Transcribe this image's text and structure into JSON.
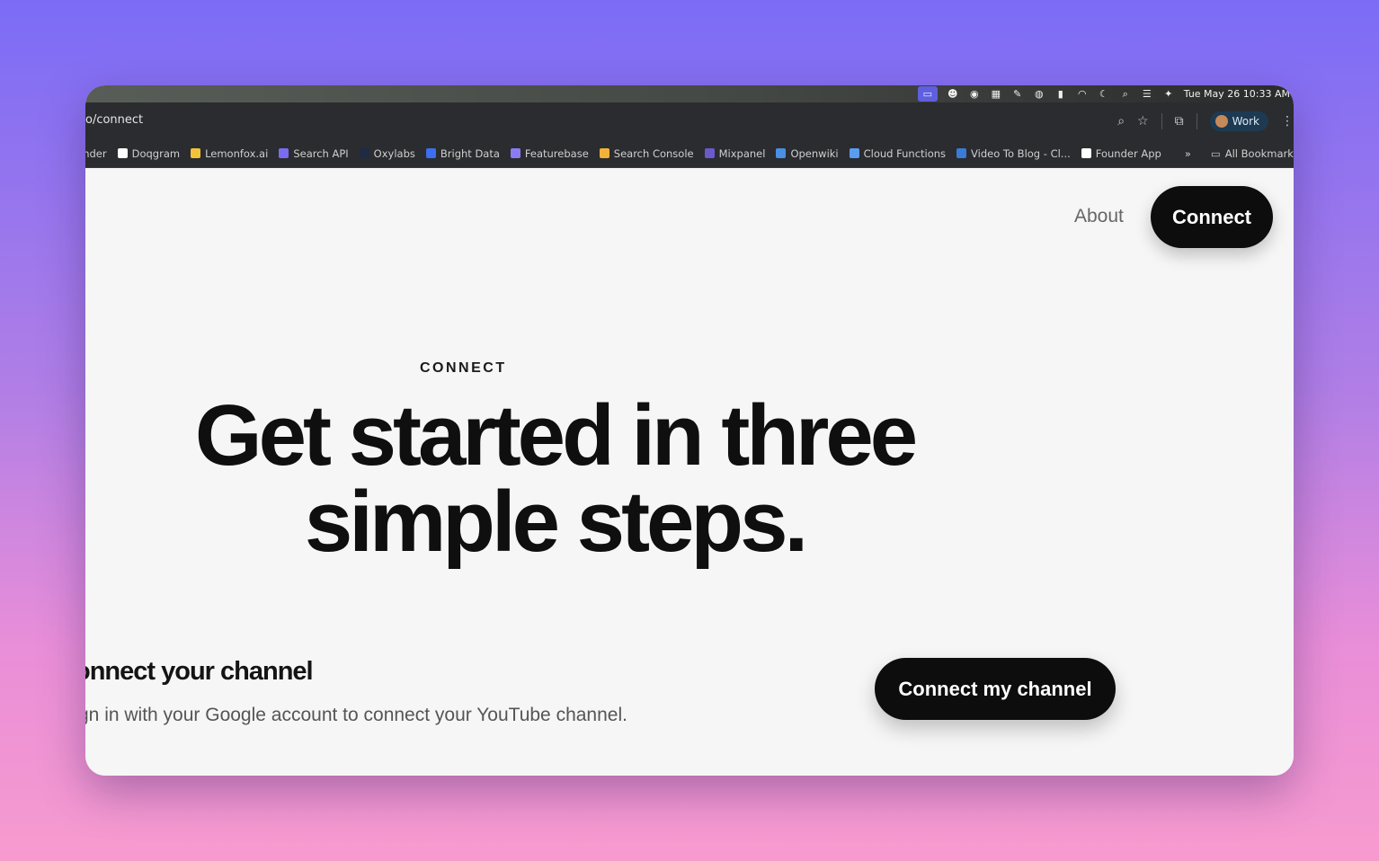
{
  "menubar": {
    "clock": "Tue May 26  10:33 AM"
  },
  "browser": {
    "url": "o/connect",
    "profile_label": "Work",
    "bookmarks": [
      {
        "label": "inder",
        "color": "#888888"
      },
      {
        "label": "Doqgram",
        "color": "#ffffff"
      },
      {
        "label": "Lemonfox.ai",
        "color": "#f2c23a"
      },
      {
        "label": "Search API",
        "color": "#7a6cf0"
      },
      {
        "label": "Oxylabs",
        "color": "#1e2b44"
      },
      {
        "label": "Bright Data",
        "color": "#3b6ef0"
      },
      {
        "label": "Featurebase",
        "color": "#8a7cf0"
      },
      {
        "label": "Search Console",
        "color": "#f2b23a"
      },
      {
        "label": "Mixpanel",
        "color": "#6a5acd"
      },
      {
        "label": "Openwiki",
        "color": "#4a90e2"
      },
      {
        "label": "Cloud Functions",
        "color": "#5a9cf0"
      },
      {
        "label": "Video To Blog - Cl...",
        "color": "#3a7bd5"
      },
      {
        "label": "Founder App",
        "color": "#ffffff"
      }
    ],
    "more_label": "»",
    "all_bookmarks_label": "All Bookmarks"
  },
  "nav": {
    "about_label": "About",
    "connect_label": "Connect"
  },
  "hero": {
    "eyebrow": "CONNECT",
    "headline_line1": "Get started in three",
    "headline_line2": "simple steps."
  },
  "step": {
    "title": "onnect your channel",
    "description": "gn in with your Google account to connect your YouTube channel.",
    "cta_label": "Connect my channel"
  }
}
